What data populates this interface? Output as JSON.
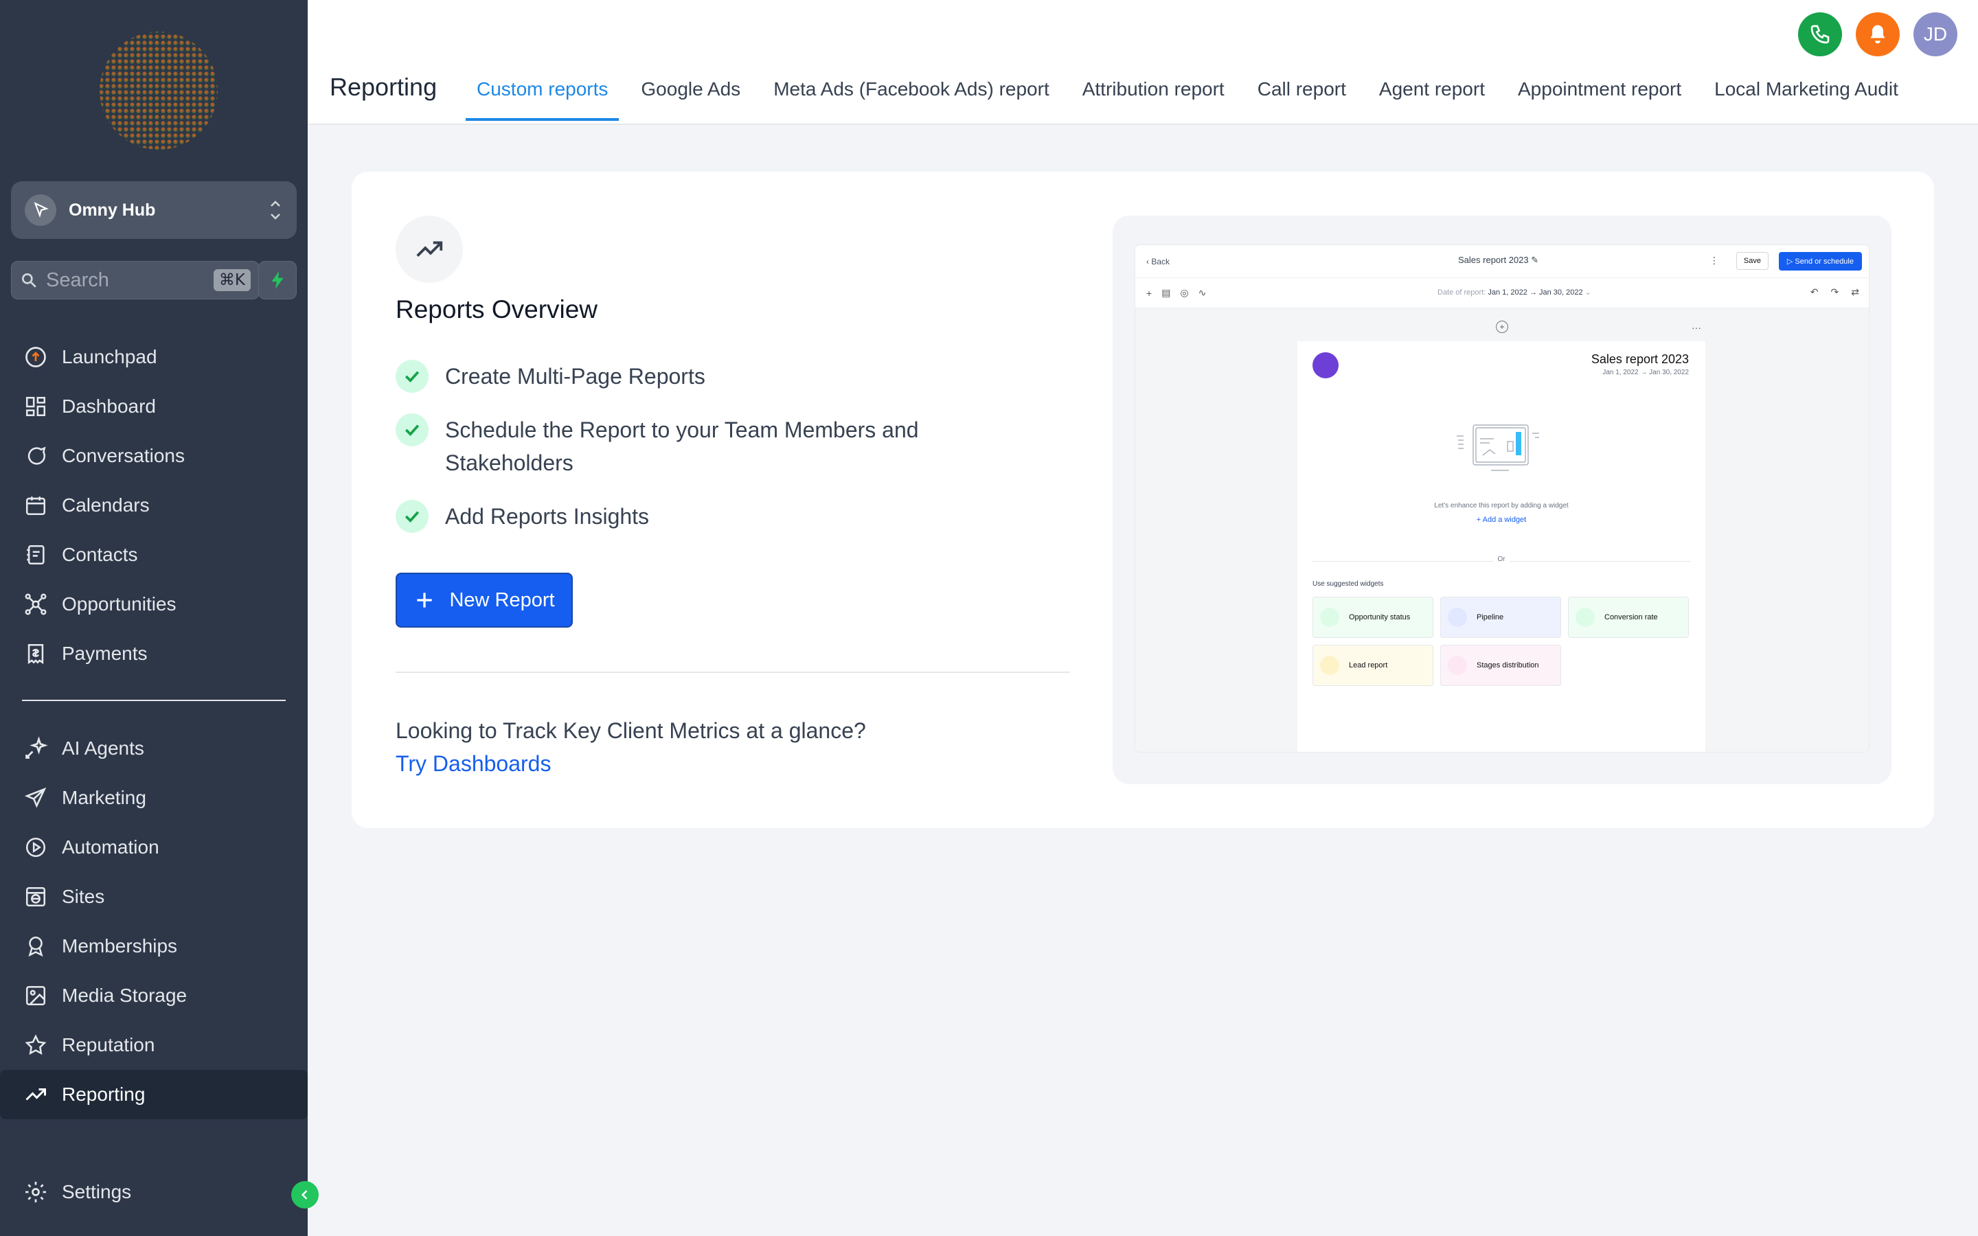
{
  "sidebar": {
    "account": {
      "name": "Omny Hub"
    },
    "search": {
      "label": "Search",
      "shortcut": "⌘K"
    },
    "nav_primary": [
      {
        "label": "Launchpad",
        "icon": "launchpad-icon"
      },
      {
        "label": "Dashboard",
        "icon": "dashboard-icon"
      },
      {
        "label": "Conversations",
        "icon": "chat-icon"
      },
      {
        "label": "Calendars",
        "icon": "calendar-icon"
      },
      {
        "label": "Contacts",
        "icon": "contacts-icon"
      },
      {
        "label": "Opportunities",
        "icon": "opportunities-icon"
      },
      {
        "label": "Payments",
        "icon": "payments-icon"
      }
    ],
    "nav_secondary": [
      {
        "label": "AI Agents",
        "icon": "sparkle-icon"
      },
      {
        "label": "Marketing",
        "icon": "send-icon"
      },
      {
        "label": "Automation",
        "icon": "automation-icon"
      },
      {
        "label": "Sites",
        "icon": "sites-icon"
      },
      {
        "label": "Memberships",
        "icon": "award-icon"
      },
      {
        "label": "Media Storage",
        "icon": "image-icon"
      },
      {
        "label": "Reputation",
        "icon": "star-icon"
      },
      {
        "label": "Reporting",
        "icon": "trend-icon",
        "active": true
      }
    ],
    "settings": {
      "label": "Settings"
    }
  },
  "header": {
    "title": "Reporting",
    "tabs": [
      {
        "label": "Custom reports",
        "active": true
      },
      {
        "label": "Google Ads"
      },
      {
        "label": "Meta Ads (Facebook Ads) report"
      },
      {
        "label": "Attribution report"
      },
      {
        "label": "Call report"
      },
      {
        "label": "Agent report"
      },
      {
        "label": "Appointment report"
      },
      {
        "label": "Local Marketing Audit"
      }
    ],
    "avatar_initials": "JD",
    "colors": {
      "phone": "#16a34a",
      "bell": "#f97316",
      "avatar": "#8b8fc9",
      "active_tab": "#1e88e5"
    }
  },
  "main": {
    "overview_title": "Reports Overview",
    "features": [
      "Create Multi-Page Reports",
      "Schedule the Report to your Team Members and Stakeholders",
      "Add Reports Insights"
    ],
    "new_report_label": "New Report",
    "track_text": "Looking to Track Key Client Metrics at a glance?",
    "track_link": "Try Dashboards",
    "colors": {
      "primary": "#155eef",
      "check_bg": "#d1fae5",
      "check": "#16a34a"
    }
  },
  "preview": {
    "back": "Back",
    "title": "Sales report 2023",
    "save": "Save",
    "send": "Send or schedule",
    "date_label": "Date of report:",
    "date_value": "Jan 1, 2022 → Jan 30, 2022",
    "page_title": "Sales report 2023",
    "page_date": "Jan 1, 2022 → Jan 30, 2022",
    "enhance": "Let's enhance this report by adding a widget",
    "add_widget": "Add a widget",
    "or": "Or",
    "use_suggested": "Use suggested widgets",
    "widgets": [
      {
        "label": "Opportunity status",
        "color": "#dcfce7"
      },
      {
        "label": "Pipeline",
        "color": "#e0e7ff"
      },
      {
        "label": "Conversion rate",
        "color": "#dcfce7"
      },
      {
        "label": "Lead report",
        "color": "#fef3c7"
      },
      {
        "label": "Stages distribution",
        "color": "#fce7f3"
      }
    ]
  }
}
